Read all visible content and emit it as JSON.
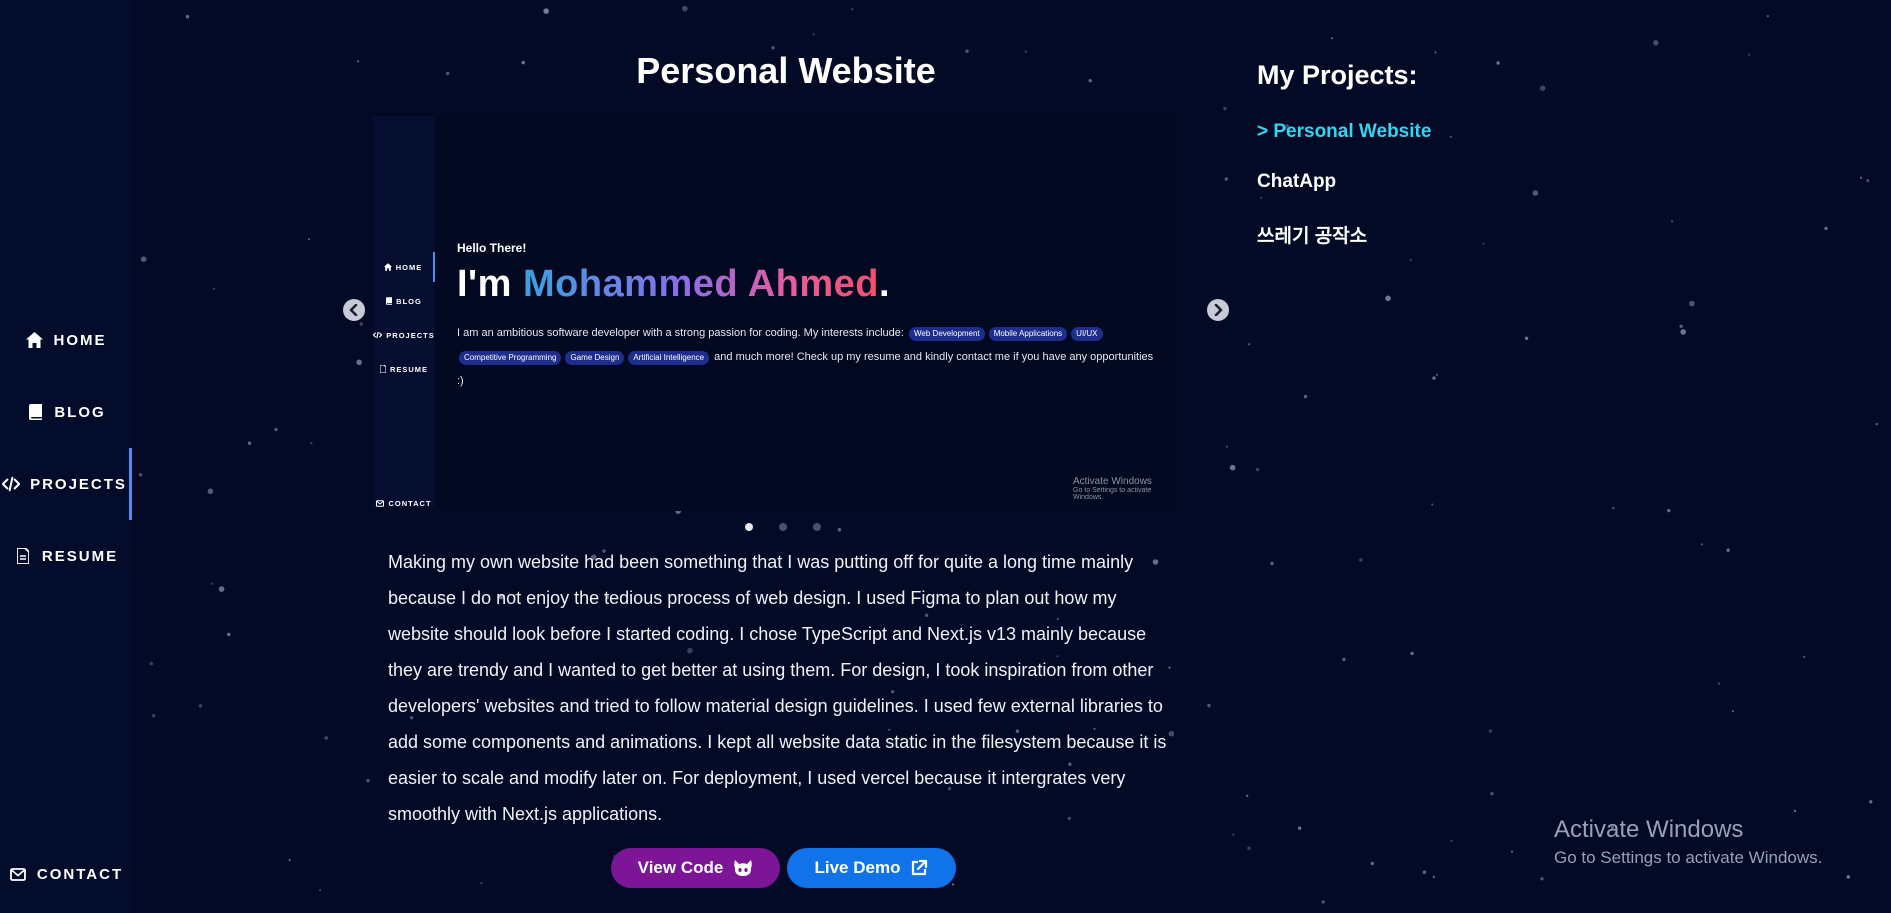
{
  "sidebar": {
    "items": [
      {
        "label": "HOME",
        "icon": "home-icon"
      },
      {
        "label": "BLOG",
        "icon": "book-icon"
      },
      {
        "label": "PROJECTS",
        "icon": "code-icon",
        "active": true
      },
      {
        "label": "RESUME",
        "icon": "document-icon"
      }
    ],
    "contact": {
      "label": "CONTACT",
      "icon": "mail-icon"
    }
  },
  "main": {
    "title": "Personal Website",
    "carousel": {
      "preview": {
        "nav": [
          "HOME",
          "BLOG",
          "PROJECTS",
          "RESUME"
        ],
        "contact": "CONTACT",
        "greeting": "Hello There!",
        "name_prefix": "I'm ",
        "name": "Mohammed Ahmed",
        "name_suffix": ".",
        "bio_intro": "I am an ambitious software developer with a strong passion for coding. My interests include:",
        "chips": [
          "Web Development",
          "Mobile Applications",
          "UI/UX",
          "Competitive Programming",
          "Game Design",
          "Artificial Intelligence"
        ],
        "bio_outro": "and much more! Check up my resume and kindly contact me if you have any opportunities :)",
        "watermark_title": "Activate Windows",
        "watermark_sub": "Go to Settings to activate Windows."
      },
      "slide_count": 3,
      "active_slide": 1
    },
    "description": "Making my own website had been something that I was putting off for quite a long time mainly because I do not enjoy the tedious process of web design. I used Figma to plan out how my website should look before I started coding. I chose TypeScript and Next.js v13 mainly because they are trendy and I wanted to get better at using them. For design, I took inspiration from other developers' websites and tried to follow material design guidelines. I used few external libraries to add some components and animations. I kept all website data static in the filesystem because it is easier to scale and modify later on. For deployment, I used vercel because it intergrates very smoothly with Next.js applications.",
    "buttons": {
      "view_code": "View Code",
      "view_code_icon": "github-icon",
      "live_demo": "Live Demo",
      "live_demo_icon": "external-link-icon"
    }
  },
  "projects": {
    "heading": "My Projects:",
    "items": [
      {
        "label": "> Personal Website",
        "active": true
      },
      {
        "label": "ChatApp"
      },
      {
        "label": "쓰레기 공작소"
      }
    ]
  },
  "watermark": {
    "title": "Activate Windows",
    "subtitle": "Go to Settings to activate Windows."
  },
  "colors": {
    "background": "#030a26",
    "sidebar": "#040c2b",
    "accent_active": "#35d4f0",
    "nav_indicator": "#4c8df2",
    "view_code_button": "#7c1596",
    "live_demo_button": "#1173ea"
  }
}
